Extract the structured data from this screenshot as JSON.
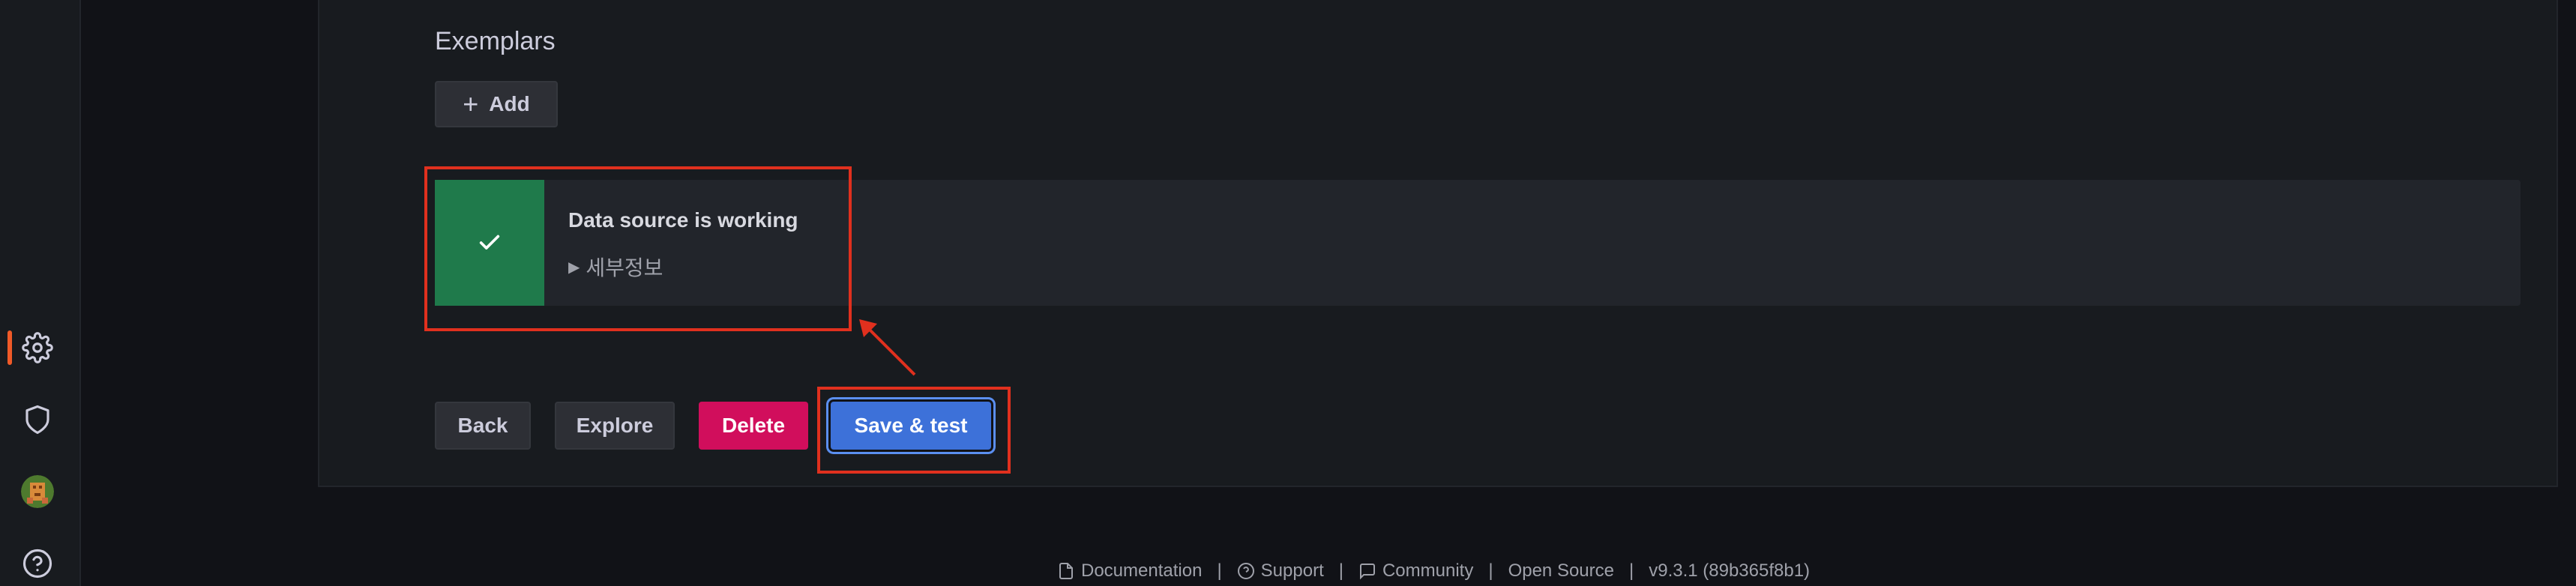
{
  "sidebar": {
    "icons": [
      {
        "name": "configuration",
        "icon": "gear-icon",
        "active": true
      },
      {
        "name": "server-admin",
        "icon": "shield-icon"
      },
      {
        "name": "profile",
        "icon": "avatar"
      },
      {
        "name": "help",
        "icon": "help-icon"
      }
    ],
    "active_color": "#f05a28"
  },
  "exemplars": {
    "title": "Exemplars",
    "add_label": "Add"
  },
  "alert": {
    "title": "Data source is working",
    "details_label": "세부정보",
    "status": "success",
    "icon": "check-icon",
    "color": "#1f7a4b"
  },
  "actions": {
    "back_label": "Back",
    "explore_label": "Explore",
    "delete_label": "Delete",
    "save_label": "Save & test"
  },
  "annotations": {
    "highlight_color": "#e0301e"
  },
  "footer": {
    "documentation": "Documentation",
    "support": "Support",
    "community": "Community",
    "open_source": "Open Source",
    "version": "v9.3.1 (89b365f8b1)"
  }
}
